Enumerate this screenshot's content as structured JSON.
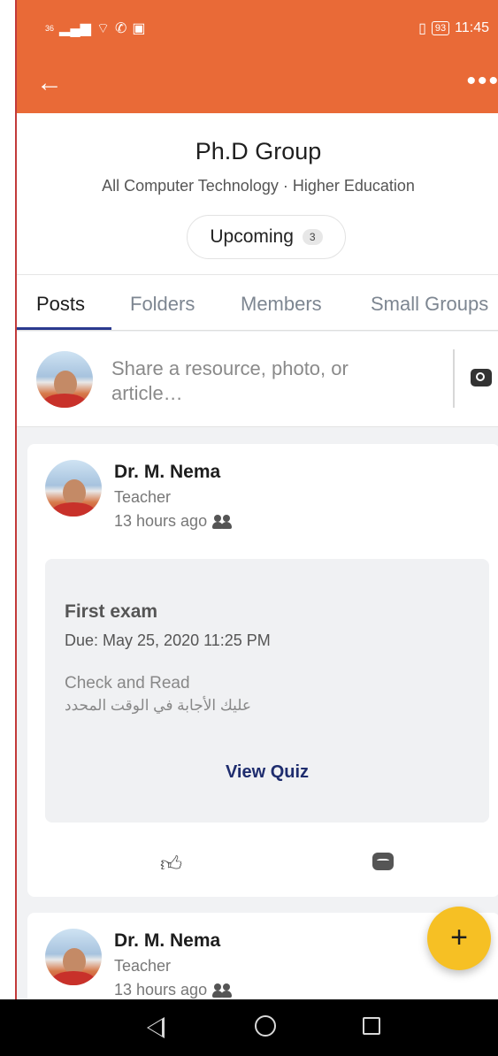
{
  "status_bar": {
    "signal": "36",
    "battery": "93",
    "time": "11:45"
  },
  "app_bar": {
    "back_icon": "arrow-left-icon",
    "more_icon": "more-horizontal-icon"
  },
  "group": {
    "title": "Ph.D Group",
    "subtitle": "All Computer Technology · Higher Education",
    "upcoming_label": "Upcoming",
    "upcoming_count": "3"
  },
  "tabs": [
    "Posts",
    "Folders",
    "Members",
    "Small Groups"
  ],
  "composer": {
    "placeholder": "Share a resource, photo, or article…",
    "camera_icon": "camera-icon"
  },
  "posts": [
    {
      "author": "Dr. M. Nema",
      "role": "Teacher",
      "time": "13 hours ago",
      "quiz": {
        "title": "First exam",
        "due": "Due: May 25, 2020 11:25 PM",
        "description": "Check and Read",
        "description_ar": "عليك الأجابة في الوقت المحدد",
        "action": "View Quiz"
      }
    },
    {
      "author": "Dr. M. Nema",
      "role": "Teacher",
      "time": "13 hours ago"
    }
  ],
  "fab": {
    "label": "+"
  },
  "colors": {
    "accent": "#e96a37",
    "tab_underline": "#2b3a8f",
    "fab": "#f6c024",
    "link": "#1f2d6e"
  }
}
